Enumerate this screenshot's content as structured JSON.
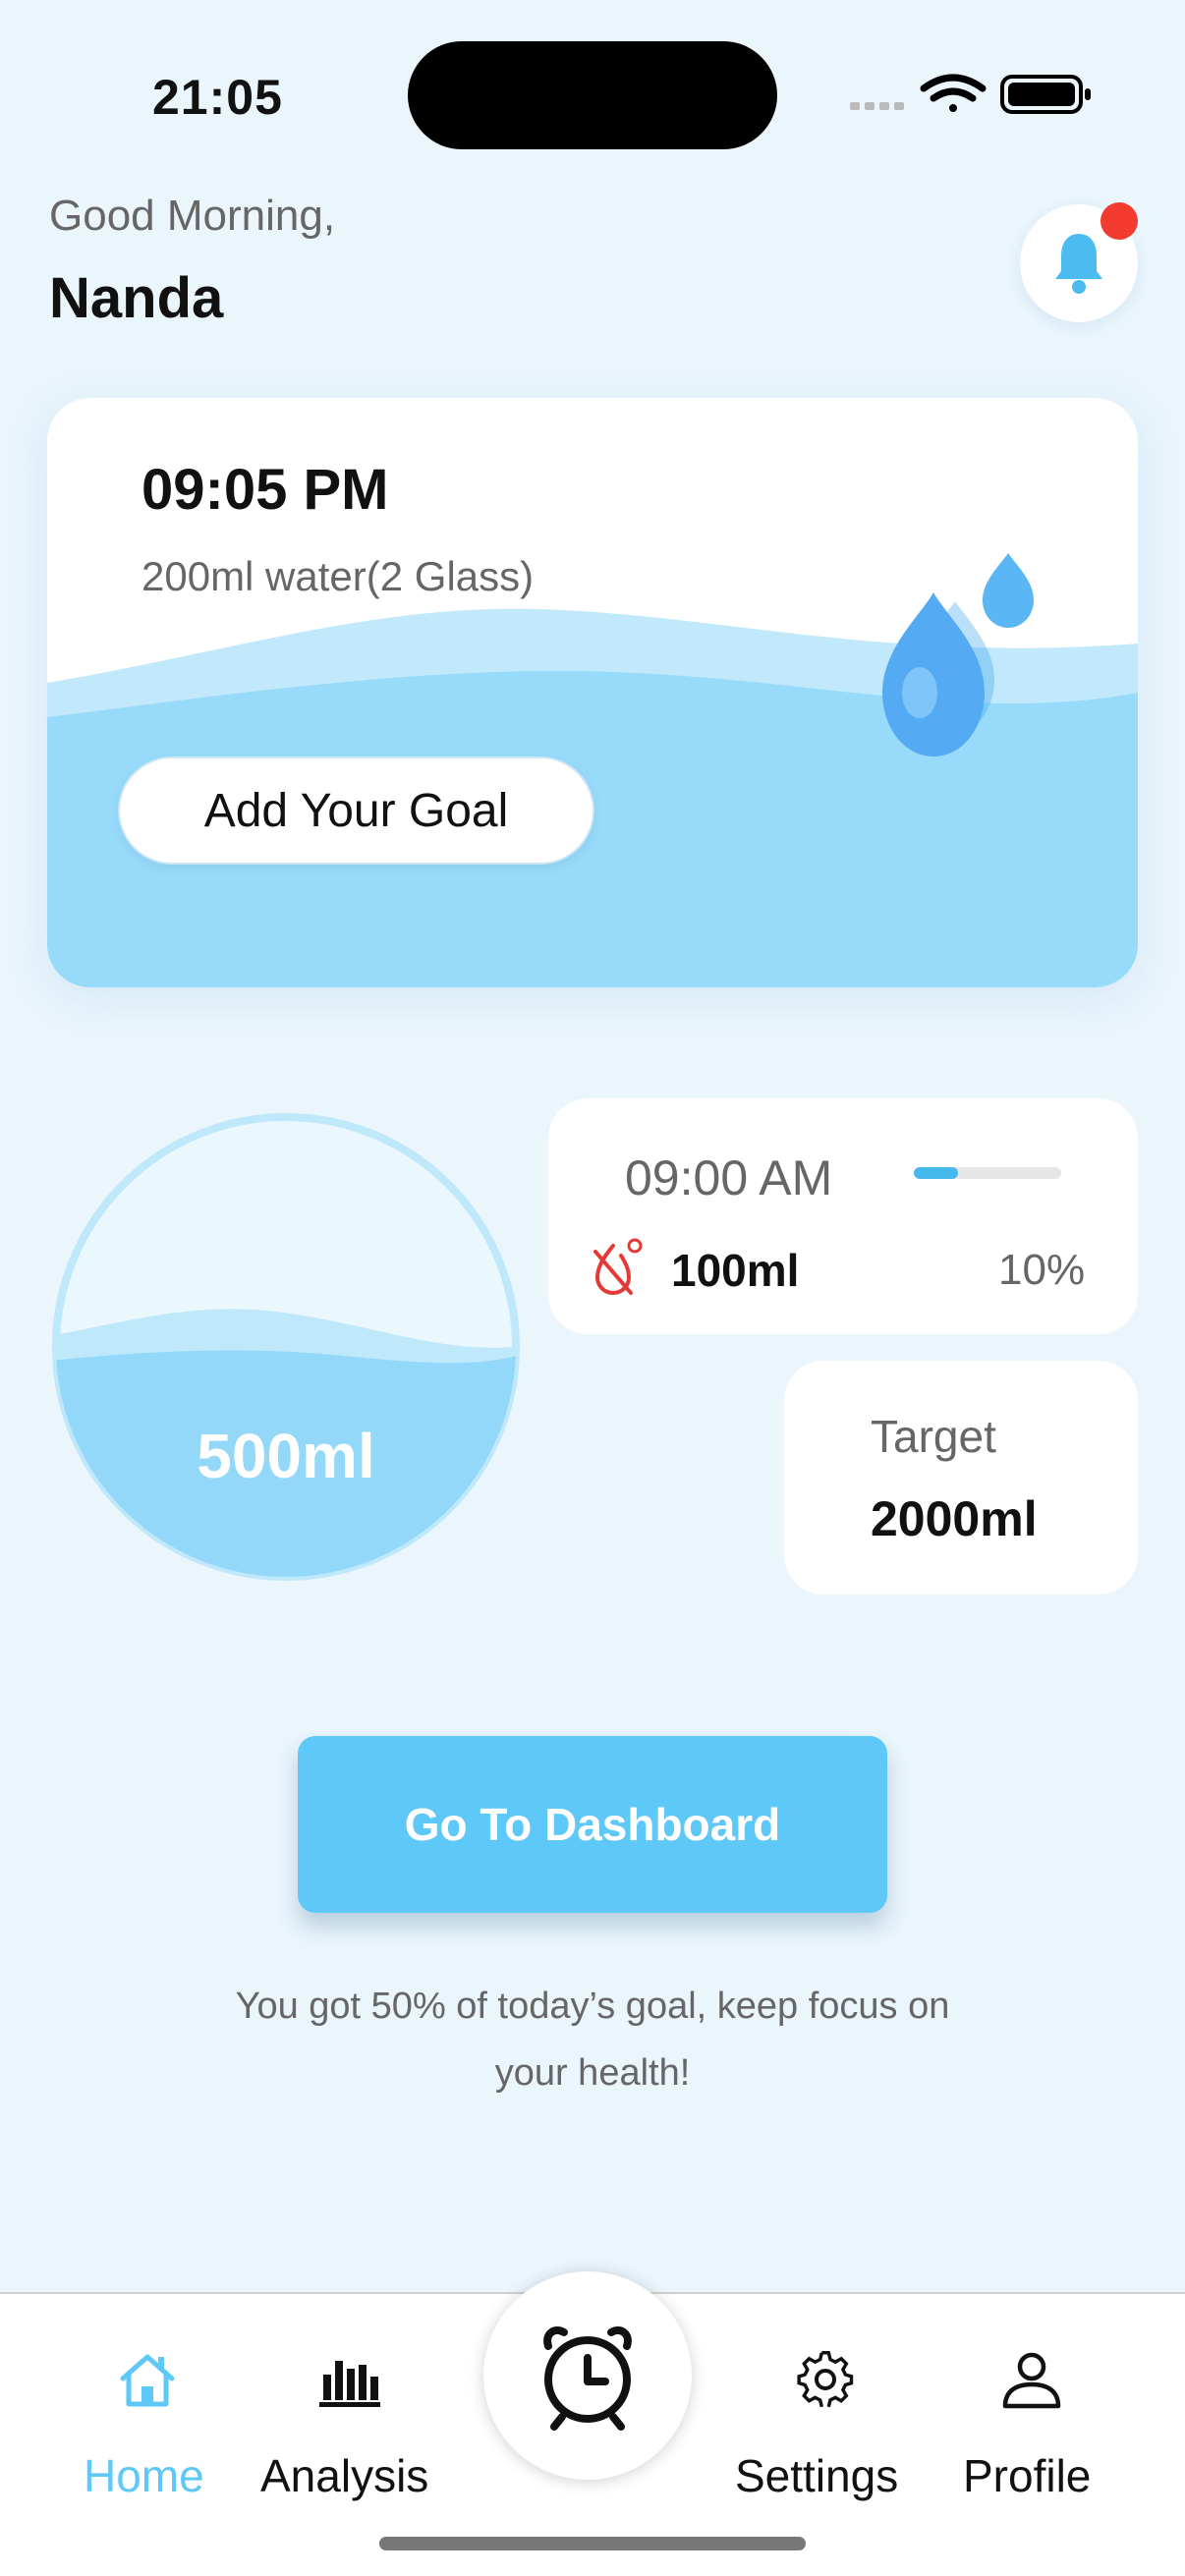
{
  "status_bar": {
    "time": "21:05"
  },
  "header": {
    "greeting": "Good Morning,",
    "username": "Nanda"
  },
  "goal_card": {
    "time": "09:05 PM",
    "amount": "200ml water(2 Glass)",
    "add_goal_label": "Add Your Goal"
  },
  "cup": {
    "label": "500ml"
  },
  "reminder": {
    "time": "09:00 AM",
    "progress": 0.3,
    "volume": "100ml",
    "percent": "10%"
  },
  "target": {
    "label": "Target",
    "value": "2000ml"
  },
  "dashboard_button": {
    "label": "Go To Dashboard"
  },
  "motivation": "You got 50% of today’s goal, keep focus on your health!",
  "tabs": [
    {
      "label": "Home",
      "icon": "home-icon",
      "active": true
    },
    {
      "label": "Analysis",
      "icon": "bar-chart-icon",
      "active": false
    },
    {
      "label": "Settings",
      "icon": "gear-icon",
      "active": false
    },
    {
      "label": "Profile",
      "icon": "person-icon",
      "active": false
    }
  ],
  "center_action": {
    "icon": "alarm-clock-icon"
  },
  "colors": {
    "accent": "#5ec8f8",
    "water": "#93d8f8",
    "alert": "#f43b30",
    "background": "#eaf5fc"
  }
}
